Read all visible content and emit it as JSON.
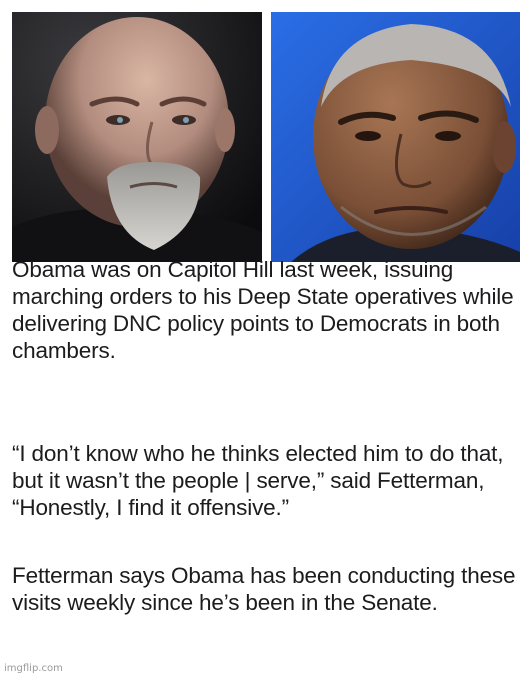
{
  "images": {
    "left_photo": {
      "subject": "bald bearded man, dark background",
      "background_color": "#1b1b1d"
    },
    "right_photo": {
      "subject": "gray-haired man, blue background",
      "background_color": "#1f56c8"
    }
  },
  "paragraphs": [
    "Obama was on Capitol Hill last week, issuing marching orders to his Deep State operatives while delivering DNC policy points to Democrats in both chambers.",
    "“I don’t know who he thinks elected him to do that, but it wasn’t the people | serve,” said Fetterman, “Honestly, I find it offensive.”",
    "Fetterman says Obama has been conducting these visits weekly since he’s been in the Senate."
  ],
  "watermark": "imgflip.com"
}
